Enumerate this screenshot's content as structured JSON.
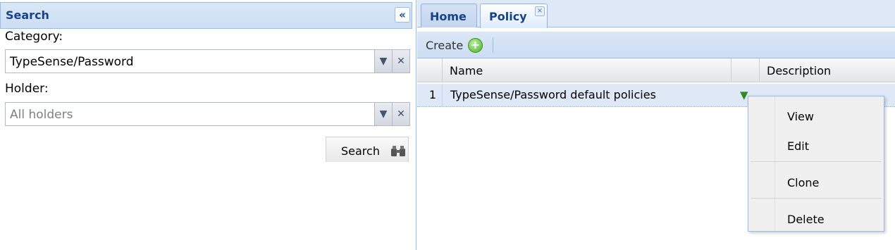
{
  "search_panel": {
    "title": "Search",
    "collapse_glyph": "«",
    "category_label": "Category:",
    "category_value": "TypeSense/Password",
    "holder_label": "Holder:",
    "holder_placeholder": "All holders",
    "search_button_label": "Search",
    "search_icon": "binoculars-icon"
  },
  "tabs": [
    {
      "label": "Home"
    },
    {
      "label": "Policy",
      "close_glyph": "×"
    }
  ],
  "toolbar": {
    "create_label": "Create",
    "create_icon": "plus-icon"
  },
  "grid": {
    "columns": [
      "Name",
      "",
      "Description"
    ],
    "rows": [
      {
        "index": "1",
        "name": "TypeSense/Password default policies",
        "action_glyph": "▼"
      }
    ]
  },
  "context_menu": {
    "items": [
      "View",
      "Edit",
      "Clone",
      "Delete"
    ]
  }
}
